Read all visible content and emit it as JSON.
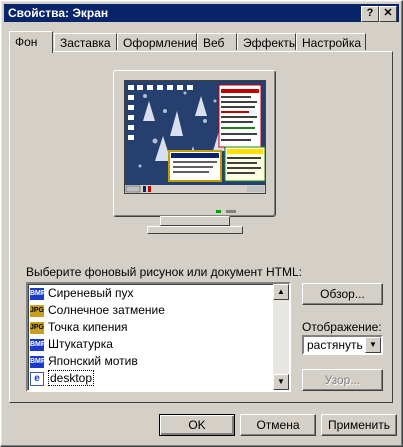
{
  "window": {
    "title": "Свойства: Экран",
    "help_glyph": "?",
    "close_glyph": "✕"
  },
  "tabs": [
    {
      "label": "Фон",
      "active": true
    },
    {
      "label": "Заставка"
    },
    {
      "label": "Оформление"
    },
    {
      "label": "Веб"
    },
    {
      "label": "Эффекты"
    },
    {
      "label": "Настройка"
    }
  ],
  "background": {
    "choose_label": "Выберите фоновый рисунок или документ HTML:",
    "items": [
      {
        "name": "Сиреневый пух",
        "icon": "bmp-icon"
      },
      {
        "name": "Солнечное затмение",
        "icon": "jpg-icon"
      },
      {
        "name": "Точка кипения",
        "icon": "jpg-icon"
      },
      {
        "name": "Штукатурка",
        "icon": "bmp-icon"
      },
      {
        "name": "Японский мотив",
        "icon": "bmp-icon"
      },
      {
        "name": "desktop",
        "icon": "html-icon",
        "selected": true
      }
    ],
    "icon_text": {
      "bmp": "BMP",
      "jpg": "JPG",
      "html": "e"
    },
    "browse_label": "Обзор...",
    "display_label": "Отображение:",
    "display_value": "растянуть",
    "pattern_label": "Узор..."
  },
  "buttons": {
    "ok": "OK",
    "cancel": "Отмена",
    "apply": "Применить"
  },
  "colors": {
    "titlebar": "#0a246a",
    "face": "#d4d0c8",
    "selection": "#0a246a"
  }
}
